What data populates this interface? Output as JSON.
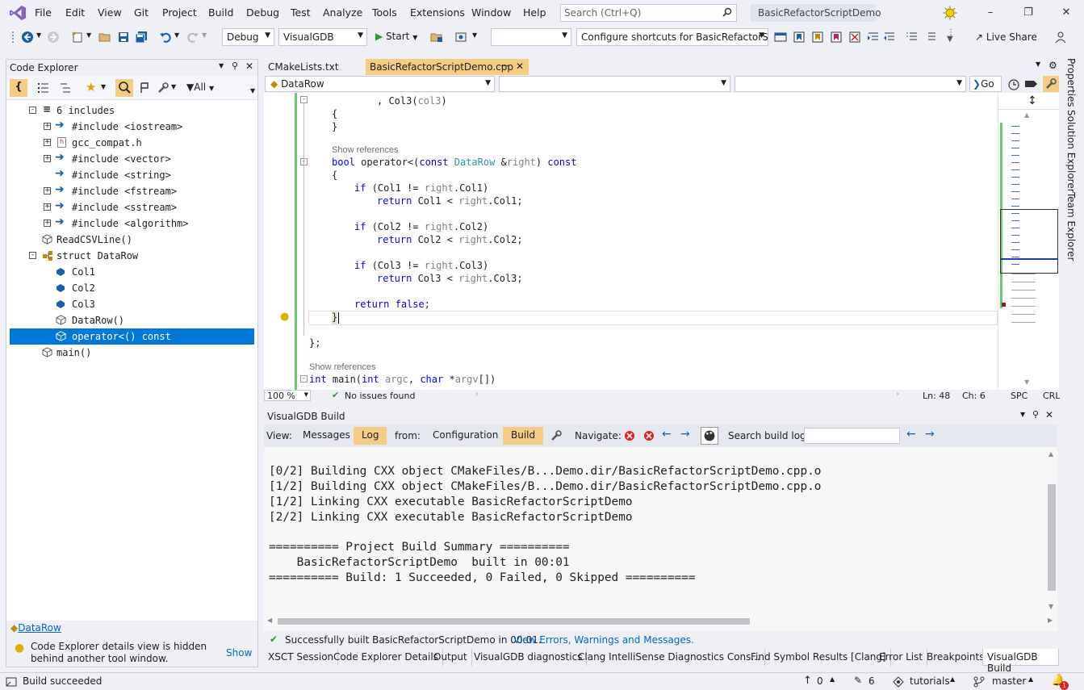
{
  "menu": [
    "File",
    "Edit",
    "View",
    "Git",
    "Project",
    "Build",
    "Debug",
    "Test",
    "Analyze",
    "Tools",
    "Extensions",
    "Window",
    "Help"
  ],
  "search": {
    "placeholder": "Search (Ctrl+Q)"
  },
  "solution_title": "BasicRefactorScriptDemo",
  "toolbar": {
    "config": "Debug",
    "platform": "VisualGDB",
    "start_label": "Start",
    "shortcuts_combo": "Configure shortcuts for BasicRefactorScrip",
    "live_share": "Live Share"
  },
  "code_explorer": {
    "title": "Code Explorer",
    "filter_label": "All",
    "tree": [
      {
        "label": "6 includes"
      },
      {
        "label": "#include <iostream>"
      },
      {
        "label": "gcc_compat.h"
      },
      {
        "label": "#include <vector>"
      },
      {
        "label": "#include <string>"
      },
      {
        "label": "#include <fstream>"
      },
      {
        "label": "#include <sstream>"
      },
      {
        "label": "#include <algorithm>"
      },
      {
        "label": "ReadCSVLine()"
      },
      {
        "label": "struct DataRow"
      },
      {
        "label": "Col1"
      },
      {
        "label": "Col2"
      },
      {
        "label": "Col3"
      },
      {
        "label": "DataRow()"
      },
      {
        "label": "operator<() const"
      },
      {
        "label": "main()"
      }
    ],
    "footer_link": "DataRow",
    "footer_hint": "Code Explorer details view is hidden behind another tool window.",
    "footer_show": "Show"
  },
  "tabs": [
    {
      "label": "CMakeLists.txt"
    },
    {
      "label": "BasicRefactorScriptDemo.cpp"
    }
  ],
  "nav": {
    "scope": "DataRow",
    "go": "Go"
  },
  "code": {
    "show_references": "Show references",
    "l1": ", Col3(",
    "l1b": "col3",
    "l1c": ")",
    "brace_open": "{",
    "brace_close": "}",
    "struct_end": "};",
    "kw_bool": "bool",
    "op_sig": "operator<(",
    "kw_const": "const",
    "ty_datarow": "DataRow",
    "amp": " &",
    "param_right": "right",
    "close_const": ") ",
    "kw_if": "if",
    "kw_return": "return",
    "kw_false": "false",
    "kw_int": "int",
    "kw_char": "char",
    "main_sig": " main(",
    "argc": "argc",
    "argv": "argv",
    "c1": "(Col1 != ",
    "c1b": ".Col1)",
    "r1": " Col1 < ",
    "r1b": ".Col1;",
    "c2": "(Col2 != ",
    "c2b": ".Col2)",
    "r2": " Col2 < ",
    "r2b": ".Col2;",
    "c3": "(Col3 != ",
    "c3b": ".Col3)",
    "r3": " Col3 < ",
    "r3b": ".Col3;"
  },
  "editor_status": {
    "zoom": "100 %",
    "issues": "No issues found",
    "ln": "Ln: 48",
    "ch": "Ch: 6",
    "spc": "SPC",
    "crlf": "CRLF"
  },
  "build_panel": {
    "title": "VisualGDB Build",
    "view_label": "View:",
    "messages": "Messages",
    "log": "Log",
    "from_label": "from:",
    "configuration": "Configuration",
    "build": "Build",
    "navigate_label": "Navigate:",
    "search_label": "Search build log:",
    "log_lines": [
      "[0/2] Building CXX object CMakeFiles/B...Demo.dir/BasicRefactorScriptDemo.cpp.o",
      "[1/2] Building CXX object CMakeFiles/B...Demo.dir/BasicRefactorScriptDemo.cpp.o",
      "[1/2] Linking CXX executable BasicRefactorScriptDemo",
      "[2/2] Linking CXX executable BasicRefactorScriptDemo",
      "",
      "========== Project Build Summary ==========",
      "    BasicRefactorScriptDemo  built in 00:01",
      "========== Build: 1 Succeeded, 0 Failed, 0 Skipped =========="
    ],
    "status_text": "Successfully built BasicRefactorScriptDemo in 00:01.",
    "status_link": "View Errors, Warnings and Messages."
  },
  "bottom_tabs": [
    "XSCT Session",
    "Code Explorer Details",
    "Output",
    "VisualGDB diagnostics",
    "Clang IntelliSense Diagnostics Cons...",
    "Find Symbol Results [Clang]",
    "Error List",
    "Breakpoints",
    "VisualGDB Build"
  ],
  "right_rail": [
    "Properties",
    "Solution Explorer",
    "Team Explorer"
  ],
  "statusbar": {
    "message": "Build succeeded",
    "up_count": "0",
    "pencil_count": "6",
    "repo": "tutorials",
    "branch": "master",
    "notif_count": "1"
  },
  "colors": {
    "accent": "#0078d7",
    "status_bg": "#eef0f5",
    "active_tab": "#f5cc84",
    "vs_purple": "#865fc5"
  }
}
